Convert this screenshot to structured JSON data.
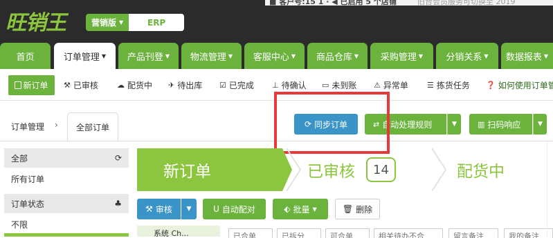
{
  "header": {
    "logo_text": "旺销王",
    "edition_label": "营销版",
    "erp_label": "ERP",
    "top_strip_left": "■ 客户号:15 1 · ◀ 已启用 5 个店铺",
    "top_strip_right": "旧台会员服务可切换至 2019"
  },
  "main_nav": {
    "tabs": [
      {
        "label": "首页",
        "dropdown": false,
        "active": false
      },
      {
        "label": "订单管理",
        "dropdown": true,
        "active": true
      },
      {
        "label": "产品刊登",
        "dropdown": true,
        "active": false
      },
      {
        "label": "物流管理",
        "dropdown": true,
        "active": false
      },
      {
        "label": "客服中心",
        "dropdown": true,
        "active": false
      },
      {
        "label": "商品仓库",
        "dropdown": true,
        "active": false
      },
      {
        "label": "采购管理",
        "dropdown": true,
        "active": false
      },
      {
        "label": "分销关系",
        "dropdown": true,
        "active": false
      },
      {
        "label": "数据报表",
        "dropdown": true,
        "active": false
      }
    ]
  },
  "sub_nav": {
    "new_order": "新订单",
    "items": [
      {
        "label": "已审核",
        "icon": "gavel-icon"
      },
      {
        "label": "配货中",
        "icon": "cloud-icon"
      },
      {
        "label": "待出库",
        "icon": "plane-icon"
      },
      {
        "label": "已完成",
        "icon": "checkbox-icon"
      },
      {
        "label": "待确认",
        "icon": "pin-icon"
      },
      {
        "label": "未到账",
        "icon": "card-icon"
      },
      {
        "label": "异常单",
        "icon": "warning-icon"
      },
      {
        "label": "拣货任务",
        "icon": "list-icon"
      },
      {
        "label": "如何使用订单管",
        "icon": "help-icon"
      }
    ]
  },
  "breadcrumb": {
    "root": "订单管理",
    "current": "全部订单"
  },
  "actions": {
    "sync": "同步订单",
    "auto_rule": "自动处理规则",
    "scan": "扫码响应"
  },
  "sidebar": {
    "section_all": "全部",
    "all_orders": "所有订单",
    "section_status": "订单状态",
    "unlimited": "不限"
  },
  "stages": {
    "new": "新订单",
    "audited": "已审核",
    "audited_count": "14",
    "allocating": "配货中"
  },
  "toolbar": {
    "audit": "审核",
    "auto_match": "自动配对",
    "batch": "批量",
    "delete": "删除"
  },
  "filters": {
    "label": "系统 Ch...",
    "chips": [
      "已合单",
      "已拆分",
      "可合单",
      "相关待办不合",
      "留言备注",
      "我的备注"
    ]
  },
  "colors": {
    "brand_green": "#6cb33e",
    "light_green": "#8cc63f",
    "blue": "#3a94c8",
    "header_dark": "#2b2b2b",
    "highlight_red": "#e8383a"
  }
}
